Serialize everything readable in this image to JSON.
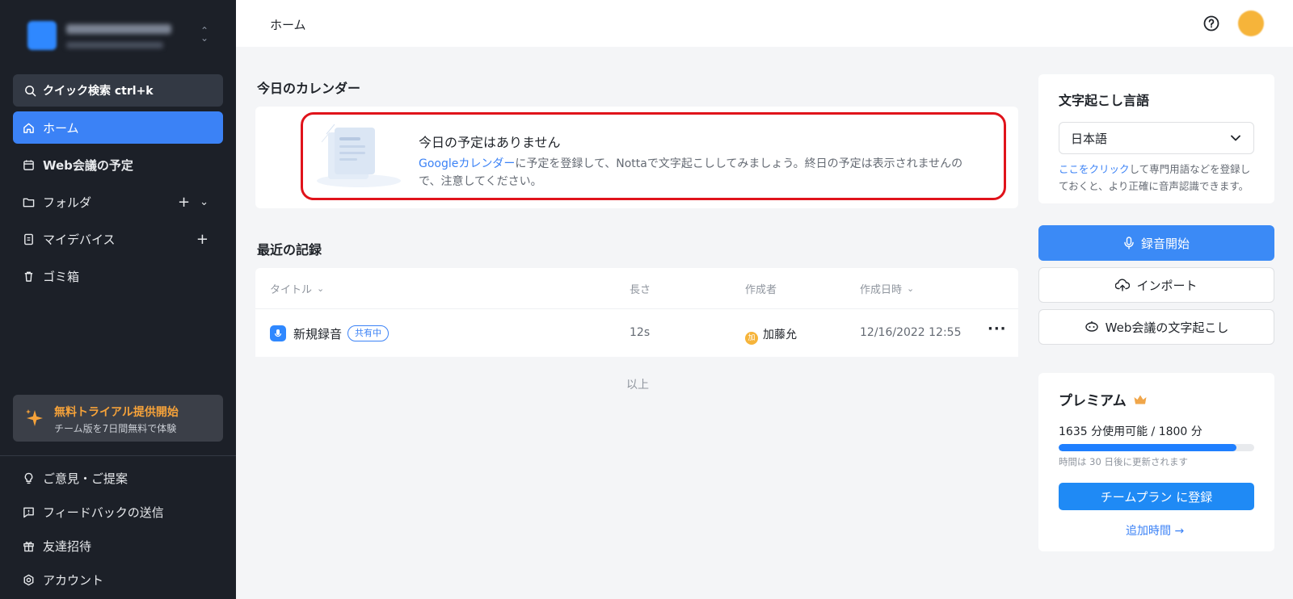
{
  "sidebar": {
    "search_label": "クイック検索 ctrl+k",
    "items": [
      {
        "label": "ホーム",
        "icon": "home-icon",
        "active": true
      },
      {
        "label": "Web会議の予定",
        "icon": "calendar-icon"
      },
      {
        "label": "フォルダ",
        "icon": "folder-icon"
      },
      {
        "label": "マイデバイス",
        "icon": "device-icon"
      },
      {
        "label": "ゴミ箱",
        "icon": "trash-icon"
      }
    ],
    "trial": {
      "title": "無料トライアル提供開始",
      "subtitle": "チーム版を7日間無料で体験"
    },
    "bottom_items": [
      {
        "label": "ご意見・ご提案",
        "icon": "lightbulb-icon"
      },
      {
        "label": "フィードバックの送信",
        "icon": "feedback-icon"
      },
      {
        "label": "友達招待",
        "icon": "gift-icon"
      },
      {
        "label": "アカウント",
        "icon": "settings-icon"
      }
    ]
  },
  "header": {
    "breadcrumb": "ホーム"
  },
  "calendar": {
    "section_title": "今日のカレンダー",
    "empty_title": "今日の予定はありません",
    "desc_link": "Googleカレンダー",
    "desc_text": "に予定を登録して、Nottaで文字起こししてみましょう。終日の予定は表示されませんので、注意してください。"
  },
  "recent": {
    "section_title": "最近の記録",
    "columns": {
      "title": "タイトル",
      "length": "長さ",
      "author": "作成者",
      "created": "作成日時"
    },
    "rows": [
      {
        "title": "新規録音",
        "badge": "共有中",
        "length": "12s",
        "author_initial": "加",
        "author": "加藤允",
        "created": "12/16/2022 12:55",
        "more": "···"
      }
    ],
    "end_label": "以上"
  },
  "right_panel": {
    "language": {
      "title": "文字起こし言語",
      "selected": "日本語",
      "note_link": "ここをクリック",
      "note_text": "して専門用語などを登録しておくと、より正確に音声認識できます。"
    },
    "actions": {
      "record": "録音開始",
      "import": "インポート",
      "meeting": "Web会議の文字起こし"
    },
    "premium": {
      "title": "プレミアム",
      "usage": "1635 分使用可能 / 1800 分",
      "used_fraction": 0.9083,
      "reset_note": "時間は 30 日後に更新されます",
      "team_button": "チームプラン に登録",
      "add_time": "追加時間 →"
    }
  },
  "colors": {
    "accent": "#3b82f6",
    "sidebar_bg": "#1c2028",
    "highlight": "#e0131b",
    "trial_text": "#f5a23a"
  }
}
